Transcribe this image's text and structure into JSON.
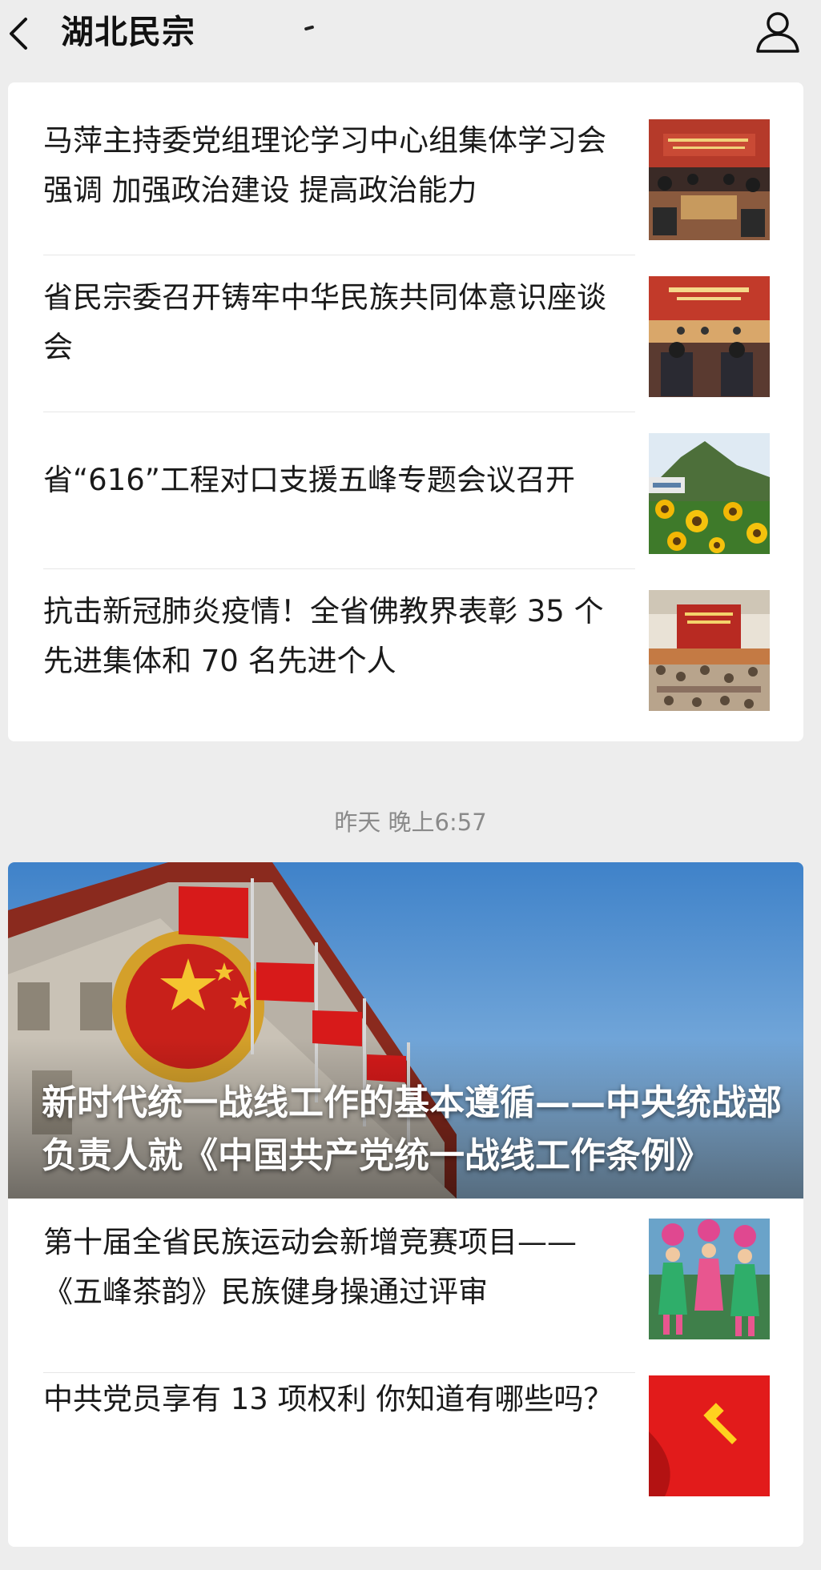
{
  "header": {
    "title": "湖北民宗",
    "back_icon": "chevron-left-icon",
    "profile_icon": "person-icon"
  },
  "group1": {
    "articles": [
      {
        "title": "马萍主持委党组理论学习中心组集体学习会强调  加强政治建设 提高政治能力"
      },
      {
        "title": "省民宗委召开铸牢中华民族共同体意识座谈会"
      },
      {
        "title": "省“616”工程对口支援五峰专题会议召开"
      },
      {
        "title": "抗击新冠肺炎疫情！全省佛教界表彰 35 个先进集体和 70 名先进个人"
      }
    ]
  },
  "timestamp": "昨天 晚上6:57",
  "group2": {
    "featured": {
      "title": "新时代统一战线工作的基本遵循——中央统战部负责人就《中国共产党统一战线工作条例》"
    },
    "articles": [
      {
        "title": "第十届全省民族运动会新增竞赛项目——《五峰茶韵》民族健身操通过评审"
      },
      {
        "title": "中共党员享有 13 项权利 你知道有哪些吗？"
      }
    ]
  },
  "colors": {
    "background": "#ededed",
    "card": "#ffffff",
    "flag_red": "#d71a1a",
    "sky_blue": "#4a8fd1"
  }
}
